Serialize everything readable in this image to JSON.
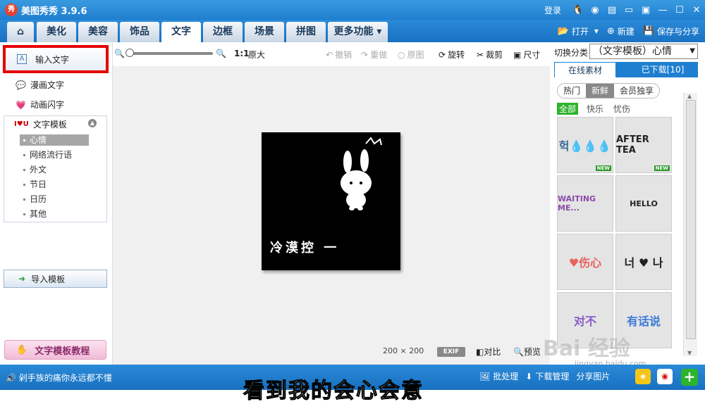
{
  "app": {
    "logo": "秀",
    "title": "美图秀秀 3.9.6",
    "login": "登录"
  },
  "title_icons": [
    "qq-icon",
    "weibo-icon",
    "skin-icon",
    "feedback-icon",
    "menu-icon",
    "minimize-icon",
    "maximize-icon",
    "close-icon"
  ],
  "menu": {
    "tabs": [
      "美化",
      "美容",
      "饰品",
      "文字",
      "边框",
      "场景",
      "拼图",
      "更多功能 ▾"
    ],
    "active_tab": "文字",
    "open": "打开",
    "new": "新建",
    "save": "保存与分享"
  },
  "left": {
    "input_text": "输入文字",
    "comic_text": "漫画文字",
    "animated_text": "动画闪字",
    "template_title": "文字模板",
    "template_subs": [
      "心情",
      "网络流行语",
      "外文",
      "节日",
      "日历",
      "其他"
    ],
    "selected_sub": "心情",
    "import_template": "导入模板",
    "tutorial": "文字模板教程"
  },
  "toolbar": {
    "ratio": "1:1",
    "original_size": "原大",
    "undo": "撤销",
    "redo": "重做",
    "original": "原图",
    "rotate": "旋转",
    "crop": "裁剪",
    "size": "尺寸"
  },
  "canvas": {
    "photo_text": "冷漠控 一",
    "image_size": "200 × 200",
    "exif": "EXIF",
    "compare": "对比",
    "preview": "预览"
  },
  "right": {
    "switch_label": "切换分类",
    "switch_value": "（文字模板）心情",
    "tabs": [
      "在线素材",
      "已下载[10]"
    ],
    "pill": [
      "热门",
      "新鲜",
      "会员独享"
    ],
    "pill_active": "新鲜",
    "categories": [
      "全部",
      "快乐",
      "忧伤"
    ],
    "category_active": "全部",
    "thumbnails": [
      {
        "text": "헉💧💧💧",
        "badge": "NEW",
        "color": "#333"
      },
      {
        "text": "AFTER TEA",
        "badge": "NEW",
        "color": "#333"
      },
      {
        "text": "WAITING ME...",
        "badge": "",
        "color": "#8a4aa8"
      },
      {
        "text": "HELLO",
        "badge": "",
        "color": "#333"
      },
      {
        "text": "♥伤心",
        "badge": "",
        "color": "#e8605a"
      },
      {
        "text": "너 ♥ 나",
        "badge": "",
        "color": "#333"
      },
      {
        "text": "对不",
        "badge": "",
        "color": "#8a5ac8"
      },
      {
        "text": "有话说",
        "badge": "",
        "color": "#3a7ad8"
      }
    ]
  },
  "status": {
    "text": "剁手族的痛你永远都不懂",
    "batch": "批处理",
    "download_mgr": "下载管理",
    "share_img": "分享图片"
  },
  "overlay_caption": "看到我的会心会意",
  "watermark": "Bai 经验",
  "watermark_sub": "jingyan.baidu.com"
}
